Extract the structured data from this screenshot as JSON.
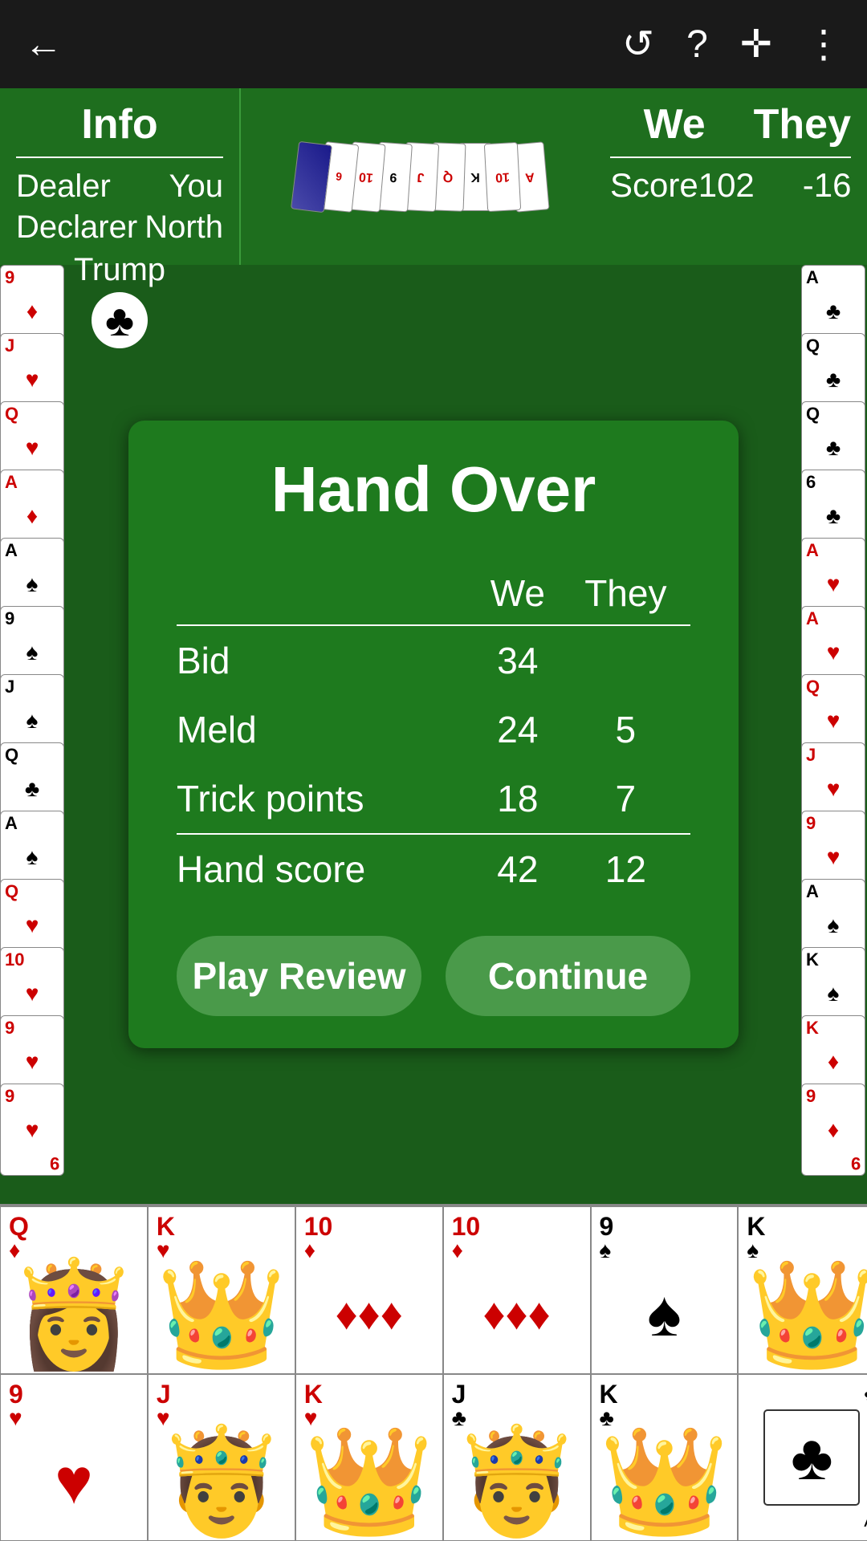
{
  "topBar": {
    "back_label": "←",
    "undo_label": "↺",
    "help_label": "?",
    "add_label": "✛",
    "more_label": "⋮"
  },
  "infoPanel": {
    "title": "Info",
    "dealer_label": "Dealer",
    "dealer_value": "You",
    "declarer_label": "Declarer",
    "declarer_value": "North",
    "trump_label": "Trump",
    "trump_symbol": "♣",
    "score_we_label": "We",
    "score_they_label": "They",
    "score_label": "Score",
    "score_we": "102",
    "score_they": "-16"
  },
  "handOver": {
    "title": "Hand Over",
    "we_label": "We",
    "they_label": "They",
    "bid_label": "Bid",
    "bid_we": "34",
    "bid_they": "",
    "meld_label": "Meld",
    "meld_we": "24",
    "meld_they": "5",
    "trick_label": "Trick points",
    "trick_we": "18",
    "trick_they": "7",
    "hand_score_label": "Hand score",
    "hand_score_we": "42",
    "hand_score_they": "12",
    "play_review_btn": "Play Review",
    "continue_btn": "Continue"
  },
  "bottomCards": {
    "row1": [
      {
        "rank": "Q",
        "suit": "♦",
        "color": "red",
        "center": "♦"
      },
      {
        "rank": "K",
        "suit": "♥",
        "color": "red",
        "center": "♥"
      },
      {
        "rank": "10",
        "suit": "♦",
        "color": "red",
        "center": "♦"
      },
      {
        "rank": "10",
        "suit": "♦",
        "color": "red",
        "center": "♦"
      },
      {
        "rank": "9",
        "suit": "♠",
        "color": "black",
        "center": "♠"
      },
      {
        "rank": "K",
        "suit": "♠",
        "color": "black",
        "center": "♠"
      }
    ],
    "row2": [
      {
        "rank": "9",
        "suit": "♥",
        "color": "red",
        "center": "♥"
      },
      {
        "rank": "J",
        "suit": "♥",
        "color": "red",
        "center": "♥"
      },
      {
        "rank": "K",
        "suit": "♥",
        "color": "red",
        "center": "♥"
      },
      {
        "rank": "J",
        "suit": "♣",
        "color": "black",
        "center": "♣"
      },
      {
        "rank": "K",
        "suit": "♣",
        "color": "black",
        "center": "♣"
      },
      {
        "rank": "A",
        "suit": "♣",
        "color": "black",
        "center": "♣",
        "back": true
      }
    ]
  },
  "leftCards": [
    {
      "rank": "9",
      "suit": "♦",
      "color": "red"
    },
    {
      "rank": "J",
      "suit": "♥",
      "color": "red"
    },
    {
      "rank": "Q",
      "suit": "♥",
      "color": "red"
    },
    {
      "rank": "A",
      "suit": "♦",
      "color": "red"
    },
    {
      "rank": "A",
      "suit": "♠",
      "color": "black"
    },
    {
      "rank": "9",
      "suit": "♠",
      "color": "black"
    },
    {
      "rank": "J",
      "suit": "♠",
      "color": "black"
    },
    {
      "rank": "Q",
      "suit": "♣",
      "color": "black"
    },
    {
      "rank": "A",
      "suit": "♠",
      "color": "black"
    },
    {
      "rank": "Q",
      "suit": "♥",
      "color": "red"
    },
    {
      "rank": "10",
      "suit": "♥",
      "color": "red"
    },
    {
      "rank": "9",
      "suit": "♥",
      "color": "red"
    },
    {
      "rank": "9",
      "suit": "♥",
      "color": "red"
    }
  ],
  "rightCards": [
    {
      "rank": "A",
      "suit": "♣",
      "color": "black"
    },
    {
      "rank": "Q",
      "suit": "♣",
      "color": "black"
    },
    {
      "rank": "Q",
      "suit": "♣",
      "color": "black"
    },
    {
      "rank": "6",
      "suit": "♣",
      "color": "black"
    },
    {
      "rank": "A",
      "suit": "♥",
      "color": "red"
    },
    {
      "rank": "A",
      "suit": "♥",
      "color": "red"
    },
    {
      "rank": "Q",
      "suit": "♥",
      "color": "red"
    },
    {
      "rank": "J",
      "suit": "♥",
      "color": "red"
    },
    {
      "rank": "9",
      "suit": "♥",
      "color": "red"
    },
    {
      "rank": "A",
      "suit": "♠",
      "color": "black"
    },
    {
      "rank": "K",
      "suit": "♠",
      "color": "black"
    },
    {
      "rank": "K",
      "suit": "♦",
      "color": "red"
    },
    {
      "rank": "9",
      "suit": "♦",
      "color": "red"
    }
  ]
}
